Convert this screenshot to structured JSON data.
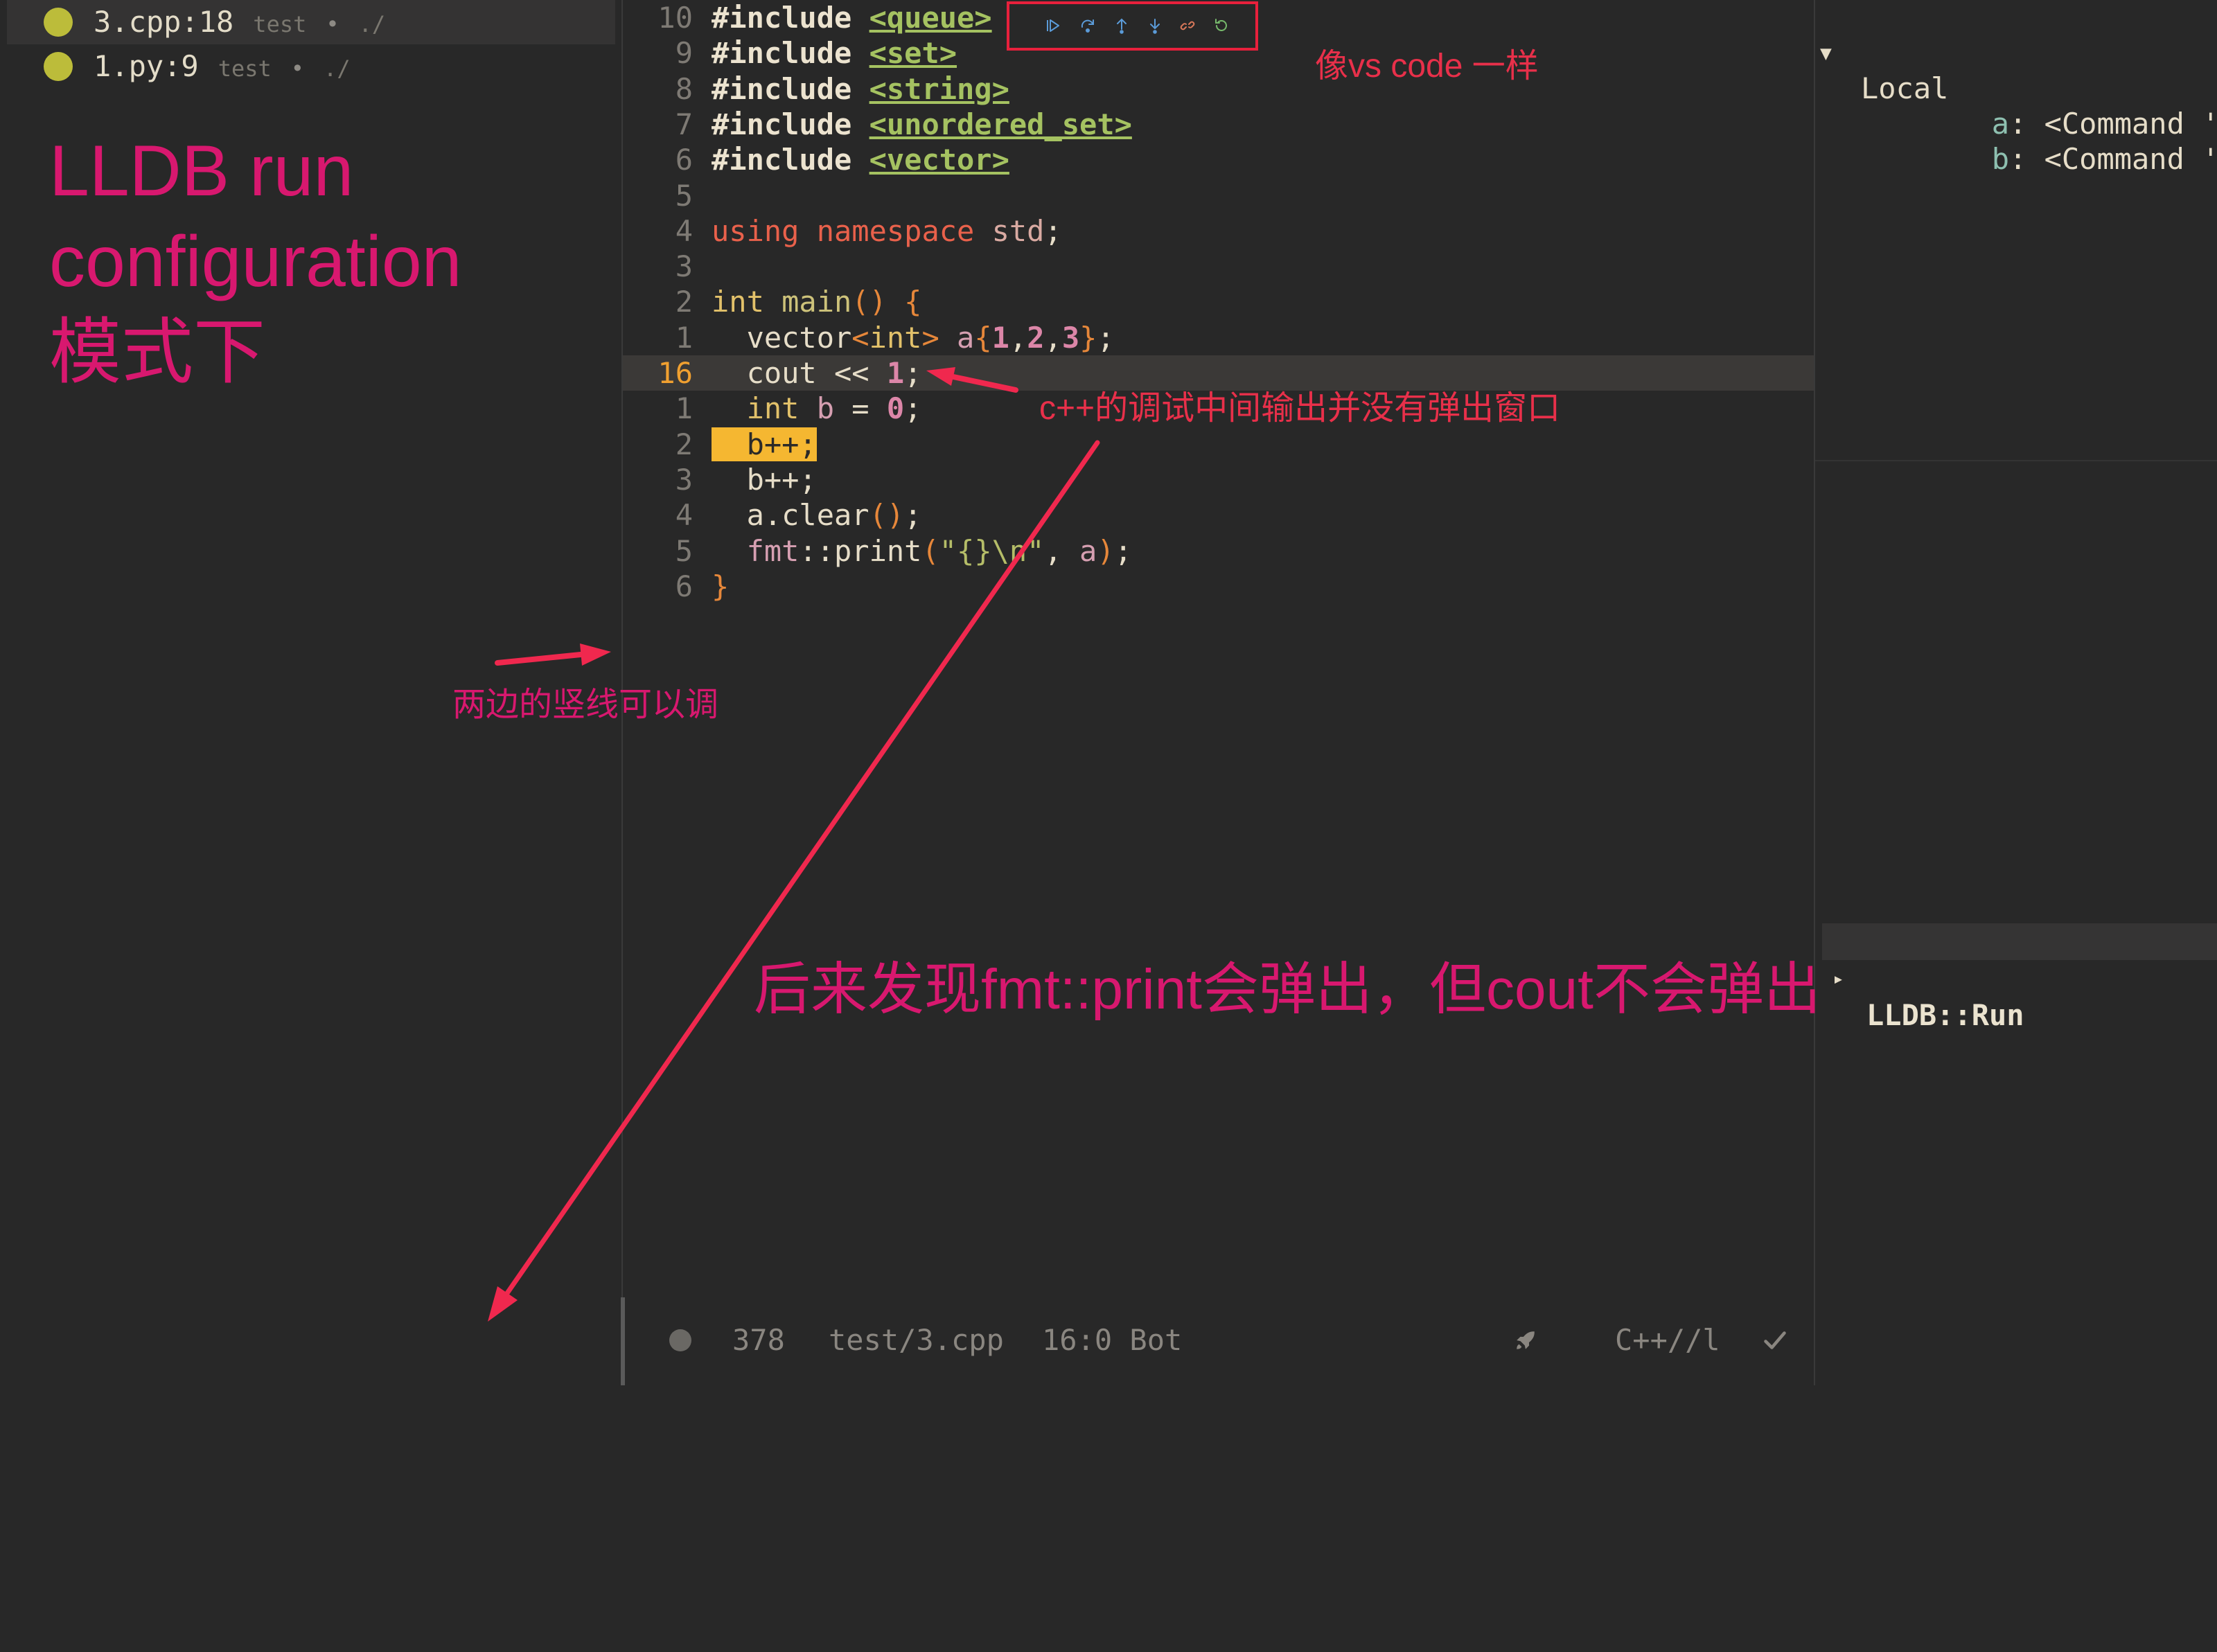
{
  "breakpoints": {
    "items": [
      {
        "location": "3.cpp:18",
        "config": "test",
        "sep": "•",
        "dir": "./",
        "dot_color": "#bcbc3a",
        "selected": true
      },
      {
        "location": "1.py:9",
        "config": "test",
        "sep": "•",
        "dir": "./",
        "dot_color": "#bcbc3a",
        "selected": false
      }
    ]
  },
  "debug_toolbar": {
    "border_color": "#e8203c",
    "buttons": [
      {
        "icon": "continue-icon",
        "color": "#5b9bd8"
      },
      {
        "icon": "step-over-icon",
        "color": "#5b9bd8"
      },
      {
        "icon": "step-out-icon",
        "color": "#5b9bd8"
      },
      {
        "icon": "step-into-icon",
        "color": "#5b9bd8"
      },
      {
        "icon": "disconnect-icon",
        "color": "#d9785a"
      },
      {
        "icon": "restart-icon",
        "color": "#76b86b"
      }
    ]
  },
  "editor": {
    "lines": [
      {
        "num": "10",
        "tokens": [
          {
            "t": "#include",
            "c": "#ece3cf",
            "b": true
          },
          {
            "t": " "
          },
          {
            "t": "<queue>",
            "c": "#a5c261",
            "b": true,
            "u": true
          }
        ]
      },
      {
        "num": "9",
        "tokens": [
          {
            "t": "#include",
            "c": "#ece3cf",
            "b": true
          },
          {
            "t": " "
          },
          {
            "t": "<set>",
            "c": "#a5c261",
            "b": true,
            "u": true
          }
        ]
      },
      {
        "num": "8",
        "tokens": [
          {
            "t": "#include",
            "c": "#ece3cf",
            "b": true
          },
          {
            "t": " "
          },
          {
            "t": "<string>",
            "c": "#a5c261",
            "b": true,
            "u": true
          }
        ]
      },
      {
        "num": "7",
        "tokens": [
          {
            "t": "#include",
            "c": "#ece3cf",
            "b": true
          },
          {
            "t": " "
          },
          {
            "t": "<unordered_set>",
            "c": "#a5c261",
            "b": true,
            "u": true
          }
        ]
      },
      {
        "num": "6",
        "tokens": [
          {
            "t": "#include",
            "c": "#ece3cf",
            "b": true
          },
          {
            "t": " "
          },
          {
            "t": "<vector>",
            "c": "#a5c261",
            "b": true,
            "u": true
          }
        ]
      },
      {
        "num": "5",
        "tokens": []
      },
      {
        "num": "4",
        "tokens": [
          {
            "t": "using",
            "c": "#e9614b"
          },
          {
            "t": " namespace",
            "c": "#e9614b"
          },
          {
            "t": " std",
            "c": "#d9aaa2"
          },
          {
            "t": ";",
            "c": "#e6ddc8"
          }
        ]
      },
      {
        "num": "3",
        "tokens": []
      },
      {
        "num": "2",
        "tokens": [
          {
            "t": "int",
            "c": "#e2c16a"
          },
          {
            "t": " main",
            "c": "#cdc27a"
          },
          {
            "t": "()",
            "c": "#e6873a"
          },
          {
            "t": " {",
            "c": "#e6873a"
          }
        ]
      },
      {
        "num": "1",
        "tokens": [
          {
            "t": "  vector",
            "c": "#e6ddc8"
          },
          {
            "t": "<",
            "c": "#e6873a"
          },
          {
            "t": "int",
            "c": "#e2c16a"
          },
          {
            "t": ">",
            "c": "#e6873a"
          },
          {
            "t": " a",
            "c": "#d69fb1"
          },
          {
            "t": "{",
            "c": "#e6873a"
          },
          {
            "t": "1",
            "c": "#dc86a8",
            "b": true
          },
          {
            "t": ",",
            "c": "#e6ddc8"
          },
          {
            "t": "2",
            "c": "#dc86a8",
            "b": true
          },
          {
            "t": ",",
            "c": "#e6ddc8"
          },
          {
            "t": "3",
            "c": "#dc86a8",
            "b": true
          },
          {
            "t": "}",
            "c": "#e6873a"
          },
          {
            "t": ";",
            "c": "#e6ddc8"
          }
        ]
      },
      {
        "num": "16",
        "current": true,
        "tokens": [
          {
            "t": "  cout <<",
            "c": "#e6ddc8"
          },
          {
            "t": " 1",
            "c": "#dc86a8",
            "b": true
          },
          {
            "t": ";",
            "c": "#e6ddc8"
          }
        ]
      },
      {
        "num": "1",
        "tokens": [
          {
            "t": "  int",
            "c": "#e2c16a"
          },
          {
            "t": " b",
            "c": "#d69fb1"
          },
          {
            "t": " =",
            "c": "#e6ddc8"
          },
          {
            "t": " 0",
            "c": "#dc86a8",
            "b": true
          },
          {
            "t": ";",
            "c": "#e6ddc8"
          }
        ]
      },
      {
        "num": "2",
        "tokens": [
          {
            "t": "  b++;",
            "c": "#2b2a28",
            "bg": "#f5b731"
          }
        ]
      },
      {
        "num": "3",
        "tokens": [
          {
            "t": "  b++;",
            "c": "#e6ddc8"
          }
        ]
      },
      {
        "num": "4",
        "tokens": [
          {
            "t": "  a.clear",
            "c": "#e6ddc8"
          },
          {
            "t": "()",
            "c": "#e6873a"
          },
          {
            "t": ";",
            "c": "#e6ddc8"
          }
        ]
      },
      {
        "num": "5",
        "tokens": [
          {
            "t": "  fmt",
            "c": "#d69fb1"
          },
          {
            "t": "::",
            "c": "#e6ddc8"
          },
          {
            "t": "print",
            "c": "#e6ddc8"
          },
          {
            "t": "(",
            "c": "#e6873a"
          },
          {
            "t": "\"{}\\n\"",
            "c": "#b5bd68"
          },
          {
            "t": ", ",
            "c": "#e6ddc8"
          },
          {
            "t": "a",
            "c": "#d69fb1"
          },
          {
            "t": ")",
            "c": "#e6873a"
          },
          {
            "t": ";",
            "c": "#e6ddc8"
          }
        ]
      },
      {
        "num": "6",
        "tokens": [
          {
            "t": "}",
            "c": "#e6873a"
          }
        ]
      }
    ]
  },
  "variables": {
    "scope": {
      "toggle": "▼",
      "label": "Local"
    },
    "items": [
      {
        "name": "a",
        "sep": ": ",
        "value": "<Command 'var-up"
      },
      {
        "name": "b",
        "sep": ": ",
        "value": "<Command 'var-up"
      }
    ],
    "run_section": {
      "toggle": "▸",
      "label": "LLDB::Run"
    }
  },
  "status_bar": {
    "dot_icon": "status-dot-icon",
    "count": "378",
    "file": "test/3.cpp",
    "position": "16:0 Bot",
    "rocket_icon": "rocket-icon",
    "filetype": "C++//l",
    "check_icon": "check-icon"
  },
  "annotations": {
    "left_title": [
      "LLDB run",
      "configuration",
      "模式下"
    ],
    "resize_note": "两边的竖线可以调",
    "toolbar_note": "像vs code 一样",
    "output_note": "c++的调试中间输出并没有弹出窗口",
    "finding_note": "后来发现fmt::print会弹出，但cout不会弹出",
    "magenta": "#d8186f",
    "red": "#e8304a",
    "arrow_color": "#f0284e"
  }
}
